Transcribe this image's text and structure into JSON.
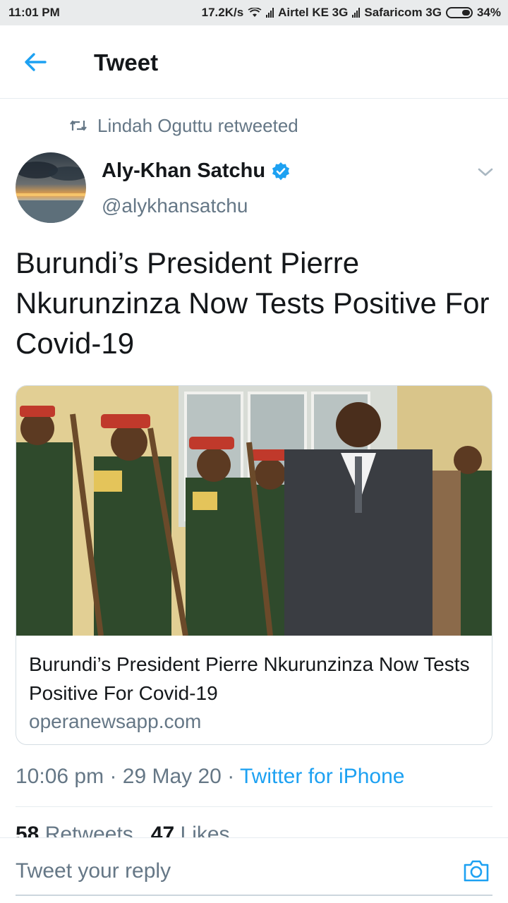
{
  "status_bar": {
    "time": "11:01 PM",
    "speed": "17.2K/s",
    "carrier1": "Airtel KE 3G",
    "carrier2": "Safaricom 3G",
    "battery": "34%"
  },
  "header": {
    "title": "Tweet",
    "back_icon": "arrow-left-icon"
  },
  "retweet": {
    "text": "Lindah Oguttu retweeted",
    "icon": "retweet-icon"
  },
  "author": {
    "name": "Aly-Khan Satchu",
    "handle": "@alykhansatchu",
    "verified_icon": "verified-badge-icon"
  },
  "tweet": {
    "text": "Burundi’s President Pierre Nkurunzinza Now Tests Positive For Covid-19"
  },
  "card": {
    "title": "Burundi’s President Pierre Nkurunzinza Now Tests Positive For Covid-19",
    "domain": "operanewsapp.com"
  },
  "meta": {
    "time": "10:06 pm",
    "separator": "·",
    "date": "29 May 20",
    "source": "Twitter for iPhone"
  },
  "stats": {
    "retweets_count": "58",
    "retweets_label": "Retweets",
    "likes_count": "47",
    "likes_label": "Likes"
  },
  "reply": {
    "placeholder": "Tweet your reply",
    "camera_icon": "camera-icon"
  },
  "colors": {
    "accent": "#1da1f2",
    "secondary_text": "#657786",
    "primary_text": "#14171a"
  }
}
